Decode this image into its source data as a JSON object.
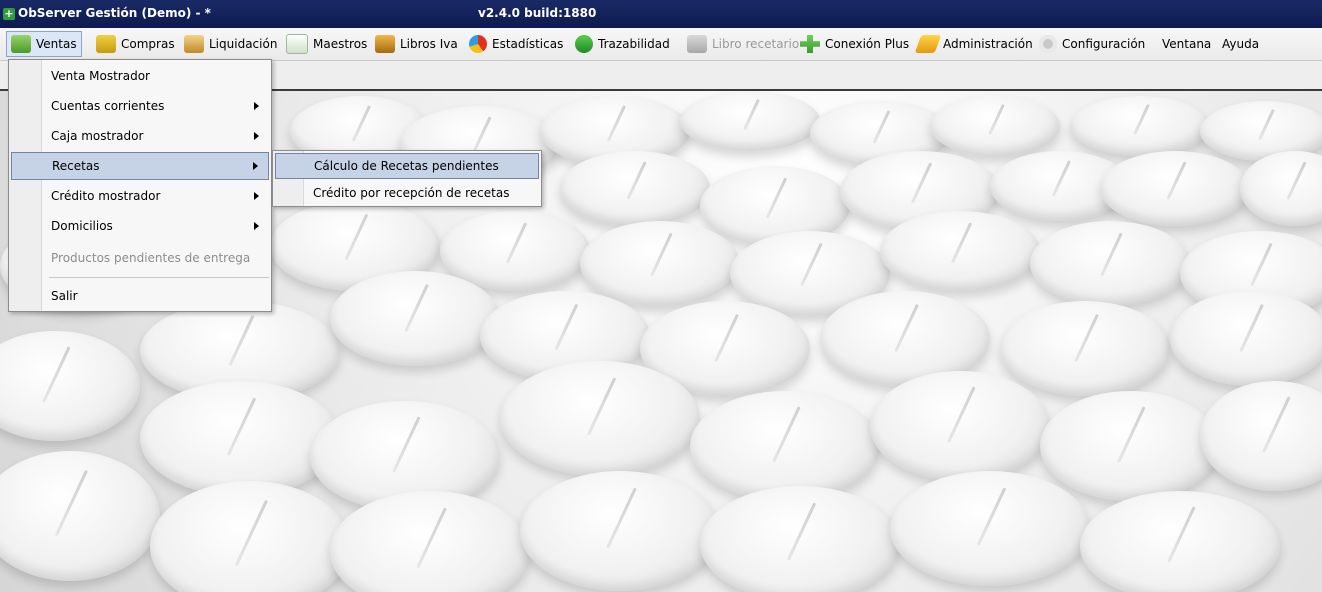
{
  "window": {
    "title": "ObServer Gestión (Demo) - *",
    "version": "v2.4.0 build:1880"
  },
  "menubar": {
    "items": [
      {
        "label": "Ventas",
        "icon": "cart-icon"
      },
      {
        "label": "Compras",
        "icon": "shopping-bag-icon"
      },
      {
        "label": "Liquidación",
        "icon": "money-icon"
      },
      {
        "label": "Maestros",
        "icon": "table-icon"
      },
      {
        "label": "Libros Iva",
        "icon": "books-icon"
      },
      {
        "label": "Estadísticas",
        "icon": "pie-chart-icon"
      },
      {
        "label": "Trazabilidad",
        "icon": "leaf-icon"
      },
      {
        "label": "Libro recetario",
        "icon": "book-icon"
      },
      {
        "label": "Conexión Plus",
        "icon": "plus-icon"
      },
      {
        "label": "Administración",
        "icon": "pencil-icon"
      },
      {
        "label": "Configuración",
        "icon": "gear-icon"
      },
      {
        "label": "Ventana"
      },
      {
        "label": "Ayuda"
      }
    ]
  },
  "ventas_menu": {
    "items": [
      {
        "label": "Venta Mostrador"
      },
      {
        "label": "Cuentas corrientes"
      },
      {
        "label": "Caja mostrador"
      },
      {
        "label": "Recetas"
      },
      {
        "label": "Crédito mostrador"
      },
      {
        "label": "Domicilios"
      },
      {
        "label": "Productos pendientes de entrega"
      },
      {
        "label": "Salir"
      }
    ]
  },
  "recetas_submenu": {
    "items": [
      {
        "label": "Cálculo de Recetas pendientes"
      },
      {
        "label": "Crédito por recepción de recetas"
      }
    ]
  }
}
